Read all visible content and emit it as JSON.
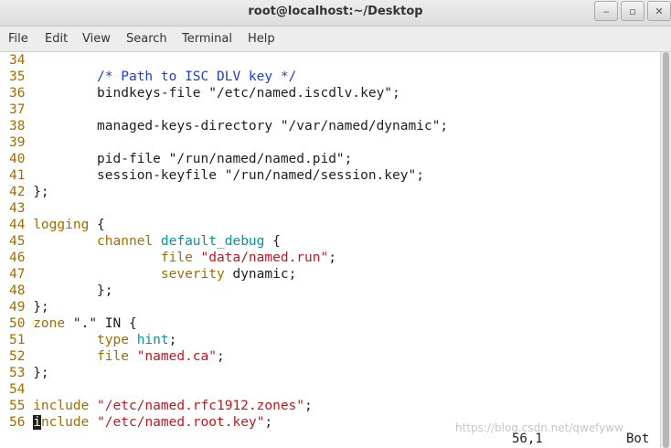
{
  "window": {
    "title": "root@localhost:~/Desktop",
    "minimize": "‒",
    "maximize": "▫",
    "close": "✕"
  },
  "menu": [
    "File",
    "Edit",
    "View",
    "Search",
    "Terminal",
    "Help"
  ],
  "lines": [
    {
      "n": "34",
      "segs": []
    },
    {
      "n": "35",
      "segs": [
        {
          "t": "        /* Path to ISC DLV key */",
          "c": "cm"
        }
      ]
    },
    {
      "n": "36",
      "segs": [
        {
          "t": "        bindkeys-file \"/etc/named.iscdlv.key\";",
          "c": ""
        }
      ]
    },
    {
      "n": "37",
      "segs": []
    },
    {
      "n": "38",
      "segs": [
        {
          "t": "        managed-keys-directory \"/var/named/dynamic\";",
          "c": ""
        }
      ]
    },
    {
      "n": "39",
      "segs": []
    },
    {
      "n": "40",
      "segs": [
        {
          "t": "        pid-file \"/run/named/named.pid\";",
          "c": ""
        }
      ]
    },
    {
      "n": "41",
      "segs": [
        {
          "t": "        session-keyfile \"/run/named/session.key\";",
          "c": ""
        }
      ]
    },
    {
      "n": "42",
      "segs": [
        {
          "t": "};",
          "c": ""
        }
      ]
    },
    {
      "n": "43",
      "segs": []
    },
    {
      "n": "44",
      "segs": [
        {
          "t": "logging",
          "c": "kw"
        },
        {
          "t": " {",
          "c": ""
        }
      ]
    },
    {
      "n": "45",
      "segs": [
        {
          "t": "        ",
          "c": ""
        },
        {
          "t": "channel",
          "c": "kw"
        },
        {
          "t": " ",
          "c": ""
        },
        {
          "t": "default_debug",
          "c": "ty"
        },
        {
          "t": " {",
          "c": ""
        }
      ]
    },
    {
      "n": "46",
      "segs": [
        {
          "t": "                ",
          "c": ""
        },
        {
          "t": "file",
          "c": "kw"
        },
        {
          "t": " ",
          "c": ""
        },
        {
          "t": "\"data/named.run\"",
          "c": "st"
        },
        {
          "t": ";",
          "c": ""
        }
      ]
    },
    {
      "n": "47",
      "segs": [
        {
          "t": "                ",
          "c": ""
        },
        {
          "t": "severity",
          "c": "kw"
        },
        {
          "t": " dynamic;",
          "c": ""
        }
      ]
    },
    {
      "n": "48",
      "segs": [
        {
          "t": "        };",
          "c": ""
        }
      ]
    },
    {
      "n": "49",
      "segs": [
        {
          "t": "};",
          "c": ""
        }
      ]
    },
    {
      "n": "50",
      "segs": [
        {
          "t": "zone",
          "c": "kw"
        },
        {
          "t": " \".\" IN {",
          "c": ""
        }
      ]
    },
    {
      "n": "51",
      "segs": [
        {
          "t": "        ",
          "c": ""
        },
        {
          "t": "type",
          "c": "kw"
        },
        {
          "t": " ",
          "c": ""
        },
        {
          "t": "hint",
          "c": "ty"
        },
        {
          "t": ";",
          "c": ""
        }
      ]
    },
    {
      "n": "52",
      "segs": [
        {
          "t": "        ",
          "c": ""
        },
        {
          "t": "file",
          "c": "kw"
        },
        {
          "t": " ",
          "c": ""
        },
        {
          "t": "\"named.ca\"",
          "c": "st"
        },
        {
          "t": ";",
          "c": ""
        }
      ]
    },
    {
      "n": "53",
      "segs": [
        {
          "t": "};",
          "c": ""
        }
      ]
    },
    {
      "n": "54",
      "segs": []
    },
    {
      "n": "55",
      "segs": [
        {
          "t": "include",
          "c": "kw"
        },
        {
          "t": " ",
          "c": ""
        },
        {
          "t": "\"/etc/named.rfc1912.zones\"",
          "c": "st"
        },
        {
          "t": ";",
          "c": ""
        }
      ]
    },
    {
      "n": "56",
      "segs": [
        {
          "t": "i",
          "c": "cursor"
        },
        {
          "t": "nclude",
          "c": "kw"
        },
        {
          "t": " ",
          "c": ""
        },
        {
          "t": "\"/etc/named.root.key\"",
          "c": "st"
        },
        {
          "t": ";",
          "c": ""
        }
      ]
    }
  ],
  "status": {
    "position": "56,1",
    "scroll": "Bot"
  },
  "watermark": "https://blog.csdn.net/qwefyww"
}
